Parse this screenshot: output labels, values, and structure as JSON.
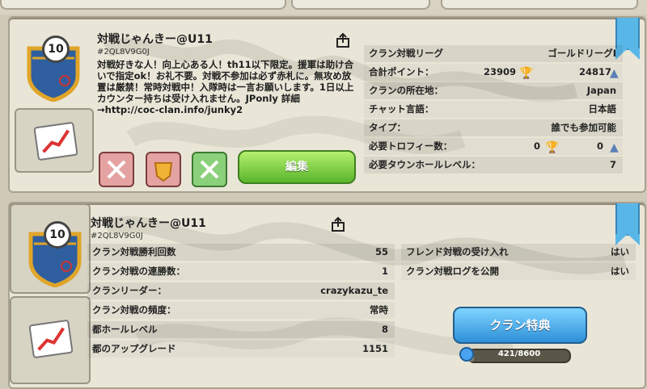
{
  "top_panel": {
    "clan_name": "対戦じゃんきー@U11",
    "clan_tag": "#2QL8V9G0J",
    "clan_level": "10",
    "description": "対戦好きな人！向上心ある人！th11以下限定。援軍は助け合いで指定ok！お礼不要。対戦不参加は必ず赤札に。無攻め放置は厳禁！常時対戦中！入隊時は一言お願いします。1日以上カウンター持ちは受け入れません。JPonly 詳細→http://coc-clan.info/junky2",
    "edit_label": "編集",
    "info_rows": [
      {
        "label": "クラン対戦リーグ",
        "value": "ゴールドリーグI"
      },
      {
        "label": "合計ポイント：",
        "value1": "23909",
        "value2": "24817"
      },
      {
        "label": "クランの所在地：",
        "value": "Japan"
      },
      {
        "label": "チャット言語：",
        "value": "日本語"
      },
      {
        "label": "タイプ：",
        "value": "誰でも参加可能"
      },
      {
        "label": "必要トロフィー数：",
        "value1": "0",
        "value2": "0"
      },
      {
        "label": "必要タウンホールレベル：",
        "value": "7"
      }
    ]
  },
  "bottom_panel": {
    "clan_name": "対戦じゃんきー@U11",
    "clan_tag": "#2QL8V9G0J",
    "clan_level": "10",
    "left_rows": [
      {
        "label": "クラン対戦勝利回数",
        "value": "55"
      },
      {
        "label": "クラン対戦の連勝数：",
        "value": "1"
      },
      {
        "label": "クランリーダー：",
        "value": "crazykazu_te"
      },
      {
        "label": "クラン対戦の頻度：",
        "value": "常時"
      },
      {
        "label": "都ホールレベル",
        "value": "8"
      },
      {
        "label": "都のアップグレード",
        "value": "1151"
      }
    ],
    "right_rows": [
      {
        "label": "フレンド対戦の受け入れ",
        "value": "はい"
      },
      {
        "label": "クラン対戦ログを公開",
        "value": "はい"
      }
    ],
    "perks_label": "クラン特典",
    "xp_text": "421/8600",
    "xp_progress": 0.049
  },
  "icons": [
    "share-icon",
    "trophy-icon",
    "versus-trophy-icon",
    "graph-icon",
    "war-league-icon",
    "map-background"
  ],
  "colors": {
    "accent_green": "#5ab52c",
    "accent_blue": "#2e8fd8",
    "ribbon": "#59b7e8",
    "panel": "#e9e6d8"
  }
}
